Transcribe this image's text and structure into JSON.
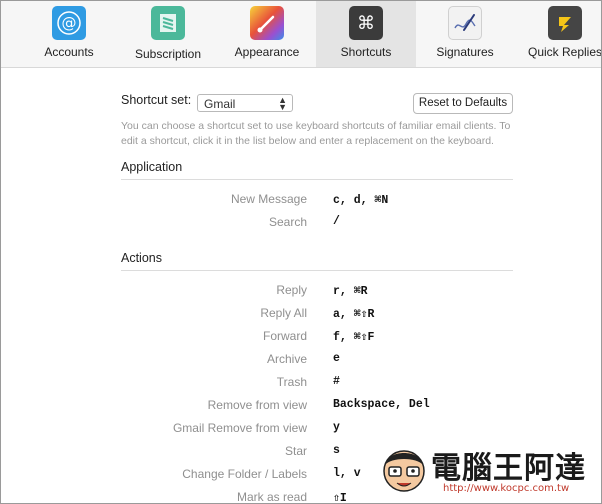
{
  "tabs": [
    {
      "label": "Accounts",
      "icon": "at-sign-icon",
      "color": "#2f9be3"
    },
    {
      "label": "Subscription",
      "icon": "book-icon",
      "color": "#4bb89a"
    },
    {
      "label": "Appearance",
      "icon": "paintbrush-icon",
      "color": "#e86a3a"
    },
    {
      "label": "Shortcuts",
      "icon": "command-icon",
      "color": "#3b3b3b",
      "selected": true
    },
    {
      "label": "Signatures",
      "icon": "signature-pen-icon",
      "color": "#f0f0f0"
    },
    {
      "label": "Quick Replies",
      "icon": "quick-reply-icon",
      "color": "#454545"
    }
  ],
  "shortcut_set": {
    "label": "Shortcut set:",
    "value": "Gmail",
    "reset_label": "Reset to Defaults"
  },
  "description": "You can choose a shortcut set to use keyboard shortcuts of familiar email clients. To edit a shortcut, click it in the list below and enter a replacement on the keyboard.",
  "sections": [
    {
      "title": "Application",
      "rows": [
        {
          "label": "New Message",
          "key": "c, d, ⌘N"
        },
        {
          "label": "Search",
          "key": "/"
        }
      ]
    },
    {
      "title": "Actions",
      "rows": [
        {
          "label": "Reply",
          "key": "r, ⌘R"
        },
        {
          "label": "Reply All",
          "key": "a, ⌘⇧R"
        },
        {
          "label": "Forward",
          "key": "f, ⌘⇧F"
        },
        {
          "label": "Archive",
          "key": "e"
        },
        {
          "label": "Trash",
          "key": "#"
        },
        {
          "label": "Remove from view",
          "key": "Backspace, Del"
        },
        {
          "label": "Gmail Remove from view",
          "key": "y"
        },
        {
          "label": "Star",
          "key": "s"
        },
        {
          "label": "Change Folder / Labels",
          "key": "l, v"
        },
        {
          "label": "Mark as read",
          "key": "⇧I"
        }
      ]
    }
  ],
  "watermark": {
    "text": "電腦王阿達",
    "url": "http://www.kocpc.com.tw"
  }
}
